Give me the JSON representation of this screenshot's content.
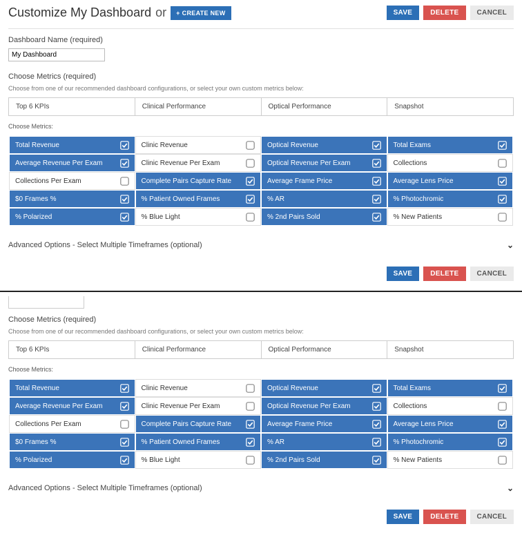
{
  "header": {
    "title": "Customize My Dashboard",
    "or": "or",
    "create_label": "CREATE NEW"
  },
  "actions": {
    "save": "SAVE",
    "delete": "DELETE",
    "cancel": "CANCEL"
  },
  "name_section": {
    "label": "Dashboard Name (required)",
    "value": "My Dashboard"
  },
  "metrics_section": {
    "label": "Choose Metrics (required)",
    "sublabel": "Choose from one of our recommended dashboard configurations, or select your own custom metrics below:",
    "tabs": [
      "Top 6 KPIs",
      "Clinical Performance",
      "Optical Performance",
      "Snapshot"
    ],
    "choose_label": "Choose Metrics:"
  },
  "metrics": [
    {
      "label": "Total Revenue",
      "selected": true
    },
    {
      "label": "Clinic Revenue",
      "selected": false
    },
    {
      "label": "Optical Revenue",
      "selected": true
    },
    {
      "label": "Total Exams",
      "selected": true
    },
    {
      "label": "Average Revenue Per Exam",
      "selected": true
    },
    {
      "label": "Clinic Revenue Per Exam",
      "selected": false
    },
    {
      "label": "Optical Revenue Per Exam",
      "selected": true
    },
    {
      "label": "Collections",
      "selected": false
    },
    {
      "label": "Collections Per Exam",
      "selected": false
    },
    {
      "label": "Complete Pairs Capture Rate",
      "selected": true
    },
    {
      "label": "Average Frame Price",
      "selected": true
    },
    {
      "label": "Average Lens Price",
      "selected": true
    },
    {
      "label": "$0 Frames %",
      "selected": true
    },
    {
      "label": "% Patient Owned Frames",
      "selected": true
    },
    {
      "label": "% AR",
      "selected": true
    },
    {
      "label": "% Photochromic",
      "selected": true
    },
    {
      "label": "% Polarized",
      "selected": true
    },
    {
      "label": "% Blue Light",
      "selected": false
    },
    {
      "label": "% 2nd Pairs Sold",
      "selected": true
    },
    {
      "label": "% New Patients",
      "selected": false
    }
  ],
  "advanced": {
    "label": "Advanced Options - Select Multiple Timeframes (optional)"
  }
}
